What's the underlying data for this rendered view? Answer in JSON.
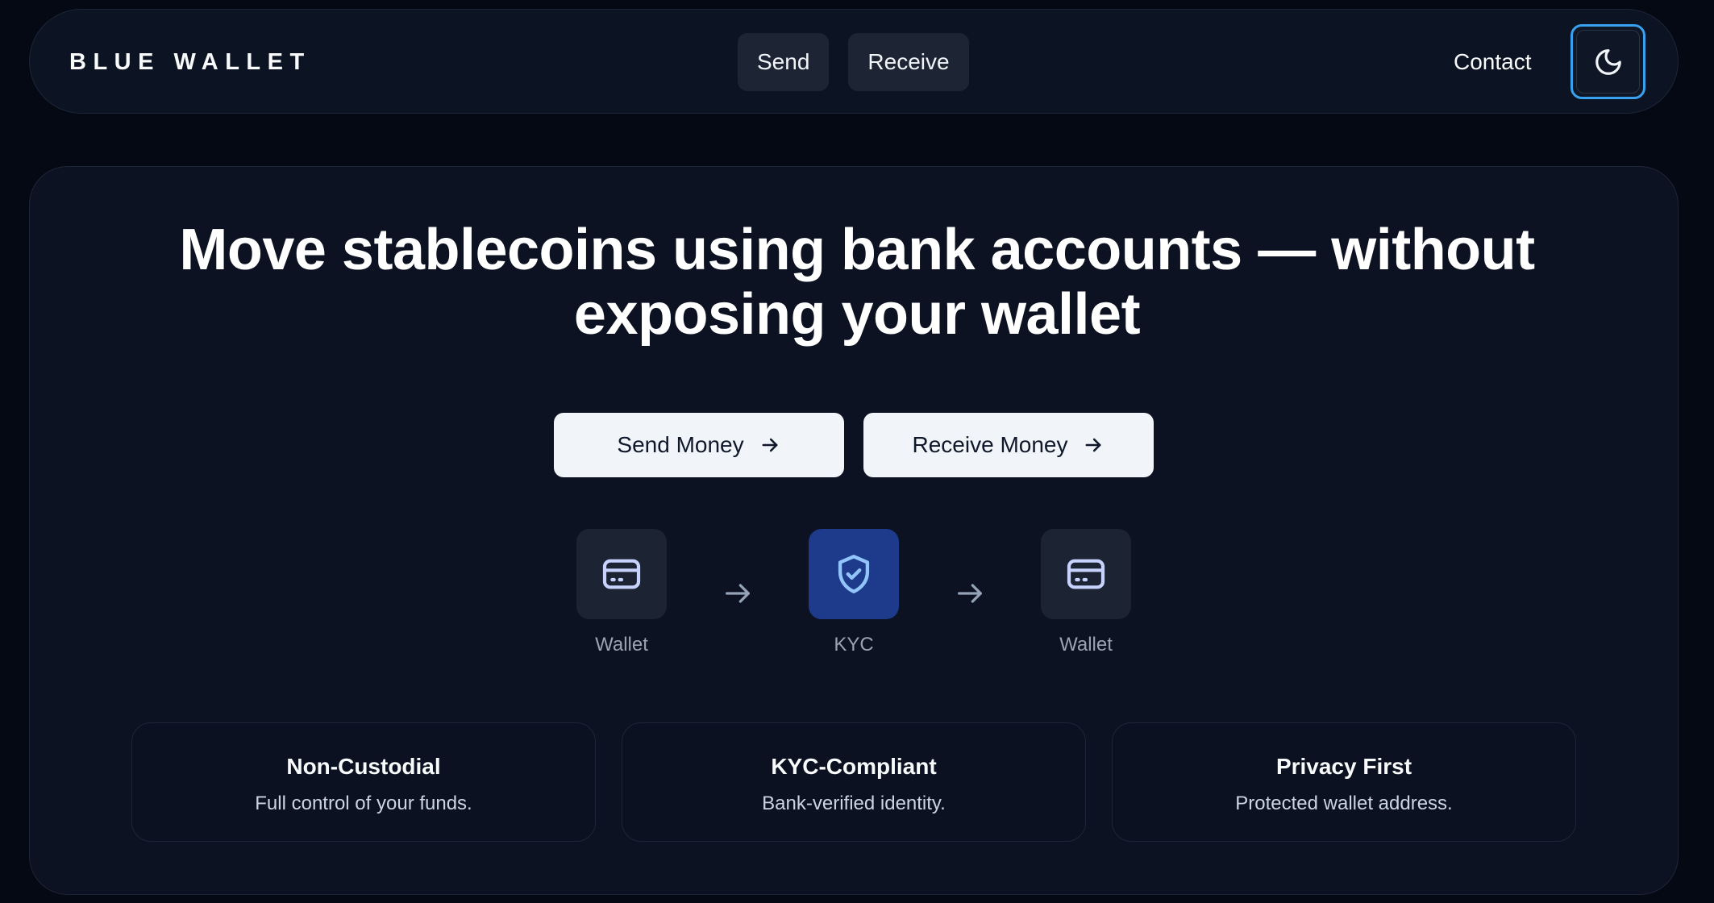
{
  "header": {
    "brand": "BLUE WALLET",
    "nav": [
      {
        "label": "Send"
      },
      {
        "label": "Receive"
      }
    ],
    "contact_label": "Contact",
    "theme_icon": "moon-icon"
  },
  "hero": {
    "headline_line1": "Move stablecoins using bank accounts — without",
    "headline_line2": "exposing your wallet",
    "cta": [
      {
        "label": "Send Money",
        "icon": "arrow-right-icon"
      },
      {
        "label": "Receive Money",
        "icon": "arrow-right-icon"
      }
    ]
  },
  "flow": [
    {
      "label": "Wallet",
      "icon": "credit-card-icon"
    },
    {
      "label": "KYC",
      "icon": "shield-check-icon"
    },
    {
      "label": "Wallet",
      "icon": "credit-card-icon"
    }
  ],
  "features": [
    {
      "title": "Non-Custodial",
      "desc": "Full control of your funds."
    },
    {
      "title": "KYC-Compliant",
      "desc": "Bank-verified identity."
    },
    {
      "title": "Privacy First",
      "desc": "Protected wallet address."
    }
  ],
  "colors": {
    "background": "#050914",
    "card": "#0c1222",
    "accent_blue": "#38a1f0",
    "kyc_box": "#1e3a8a",
    "button_light": "#f1f5f9"
  }
}
